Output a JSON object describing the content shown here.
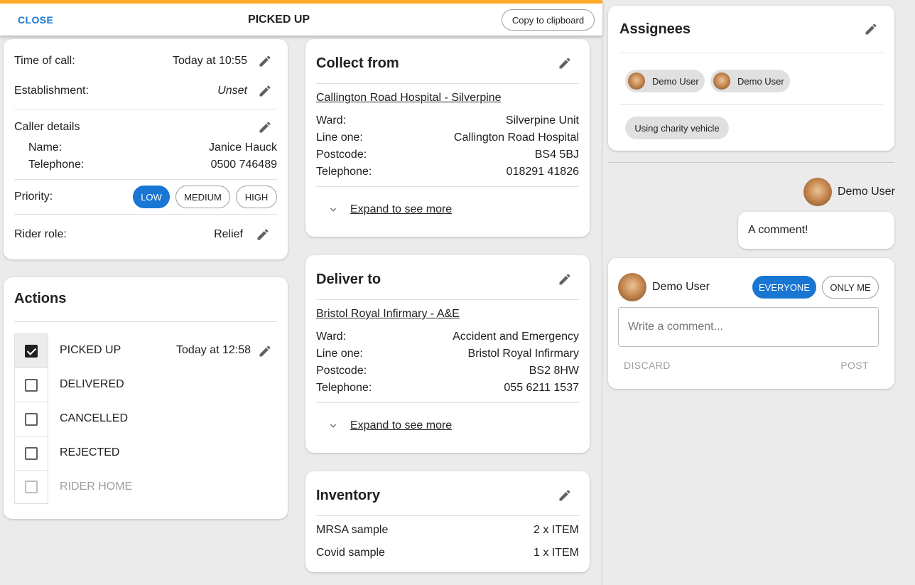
{
  "header": {
    "close_label": "CLOSE",
    "title": "PICKED UP",
    "copy_label": "Copy to clipboard",
    "accent_color": "#ffa726"
  },
  "details": {
    "time_of_call_label": "Time of call:",
    "time_of_call_value": "Today at 10:55",
    "establishment_label": "Establishment:",
    "establishment_value": "Unset",
    "caller_details_label": "Caller details",
    "name_label": "Name:",
    "name_value": "Janice Hauck",
    "telephone_label": "Telephone:",
    "telephone_value": "0500 746489",
    "priority_label": "Priority:",
    "priority_options": [
      "LOW",
      "MEDIUM",
      "HIGH"
    ],
    "priority_selected": "LOW",
    "rider_role_label": "Rider role:",
    "rider_role_value": "Relief"
  },
  "actions": {
    "title": "Actions",
    "items": [
      {
        "label": "PICKED UP",
        "checked": true,
        "time": "Today at 12:58"
      },
      {
        "label": "DELIVERED",
        "checked": false
      },
      {
        "label": "CANCELLED",
        "checked": false
      },
      {
        "label": "REJECTED",
        "checked": false
      },
      {
        "label": "RIDER HOME",
        "checked": false,
        "disabled": true
      }
    ]
  },
  "collect": {
    "title": "Collect from",
    "location": "Callington Road Hospital - Silverpine",
    "ward_label": "Ward:",
    "ward_value": "Silverpine Unit",
    "line_one_label": "Line one:",
    "line_one_value": "Callington Road Hospital",
    "postcode_label": "Postcode:",
    "postcode_value": "BS4 5BJ",
    "telephone_label": "Telephone:",
    "telephone_value": "018291 41826",
    "expand_label": "Expand to see more"
  },
  "deliver": {
    "title": "Deliver to",
    "location": "Bristol Royal Infirmary - A&E",
    "ward_label": "Ward:",
    "ward_value": "Accident and Emergency",
    "line_one_label": "Line one:",
    "line_one_value": "Bristol Royal Infirmary",
    "postcode_label": "Postcode:",
    "postcode_value": "BS2 8HW",
    "telephone_label": "Telephone:",
    "telephone_value": "055 6211 1537",
    "expand_label": "Expand to see more"
  },
  "inventory": {
    "title": "Inventory",
    "items": [
      {
        "name": "MRSA sample",
        "qty": "2 x ITEM"
      },
      {
        "name": "Covid sample",
        "qty": "1 x ITEM"
      }
    ]
  },
  "assignees": {
    "title": "Assignees",
    "users": [
      "Demo User",
      "Demo User"
    ],
    "charity_chip": "Using charity vehicle"
  },
  "comments": {
    "items": [
      {
        "author": "Demo User",
        "text": "A comment!"
      }
    ],
    "composer": {
      "author": "Demo User",
      "visibility_options": [
        "EVERYONE",
        "ONLY ME"
      ],
      "visibility_selected": "EVERYONE",
      "placeholder": "Write a comment...",
      "discard_label": "DISCARD",
      "post_label": "POST"
    }
  },
  "colors": {
    "primary": "#1976d2",
    "background": "#ebebeb",
    "card": "#ffffff"
  }
}
